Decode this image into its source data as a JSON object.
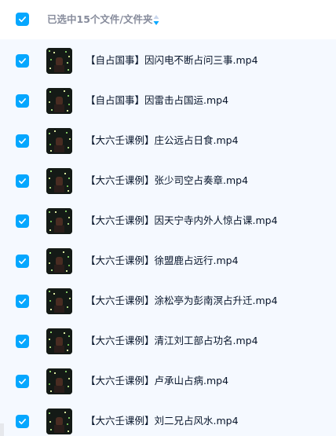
{
  "header": {
    "selection_text": "已选中15个文件/文件夹",
    "sort_icon": "sort-arrows-icon",
    "checkbox_icon": "checkmark-icon"
  },
  "colors": {
    "accent": "#06a7ff",
    "list_background": "#f5f9ff",
    "header_text": "#878c9c",
    "file_text": "#06142a"
  },
  "files": [
    {
      "name": "【自占国事】因闪电不断占问三事.mp4",
      "checked": true,
      "icon": "video-thumbnail-icon"
    },
    {
      "name": "【自占国事】因雷击占国运.mp4",
      "checked": true,
      "icon": "video-thumbnail-icon"
    },
    {
      "name": "【大六壬课例】庄公远占日食.mp4",
      "checked": true,
      "icon": "video-thumbnail-icon"
    },
    {
      "name": "【大六壬课例】张少司空占奏章.mp4",
      "checked": true,
      "icon": "video-thumbnail-icon"
    },
    {
      "name": "【大六壬课例】因天宁寺内外人惊占课.mp4",
      "checked": true,
      "icon": "video-thumbnail-icon"
    },
    {
      "name": "【大六壬课例】徐盟鹿占远行.mp4",
      "checked": true,
      "icon": "video-thumbnail-icon"
    },
    {
      "name": "【大六壬课例】涂松亭为彭南溟占升迁.mp4",
      "checked": true,
      "icon": "video-thumbnail-icon"
    },
    {
      "name": "【大六壬课例】清江刘工部占功名.mp4",
      "checked": true,
      "icon": "video-thumbnail-icon"
    },
    {
      "name": "【大六壬课例】卢承山占病.mp4",
      "checked": true,
      "icon": "video-thumbnail-icon"
    },
    {
      "name": "【大六壬课例】刘二兄占风水.mp4",
      "checked": true,
      "icon": "video-thumbnail-icon"
    }
  ]
}
